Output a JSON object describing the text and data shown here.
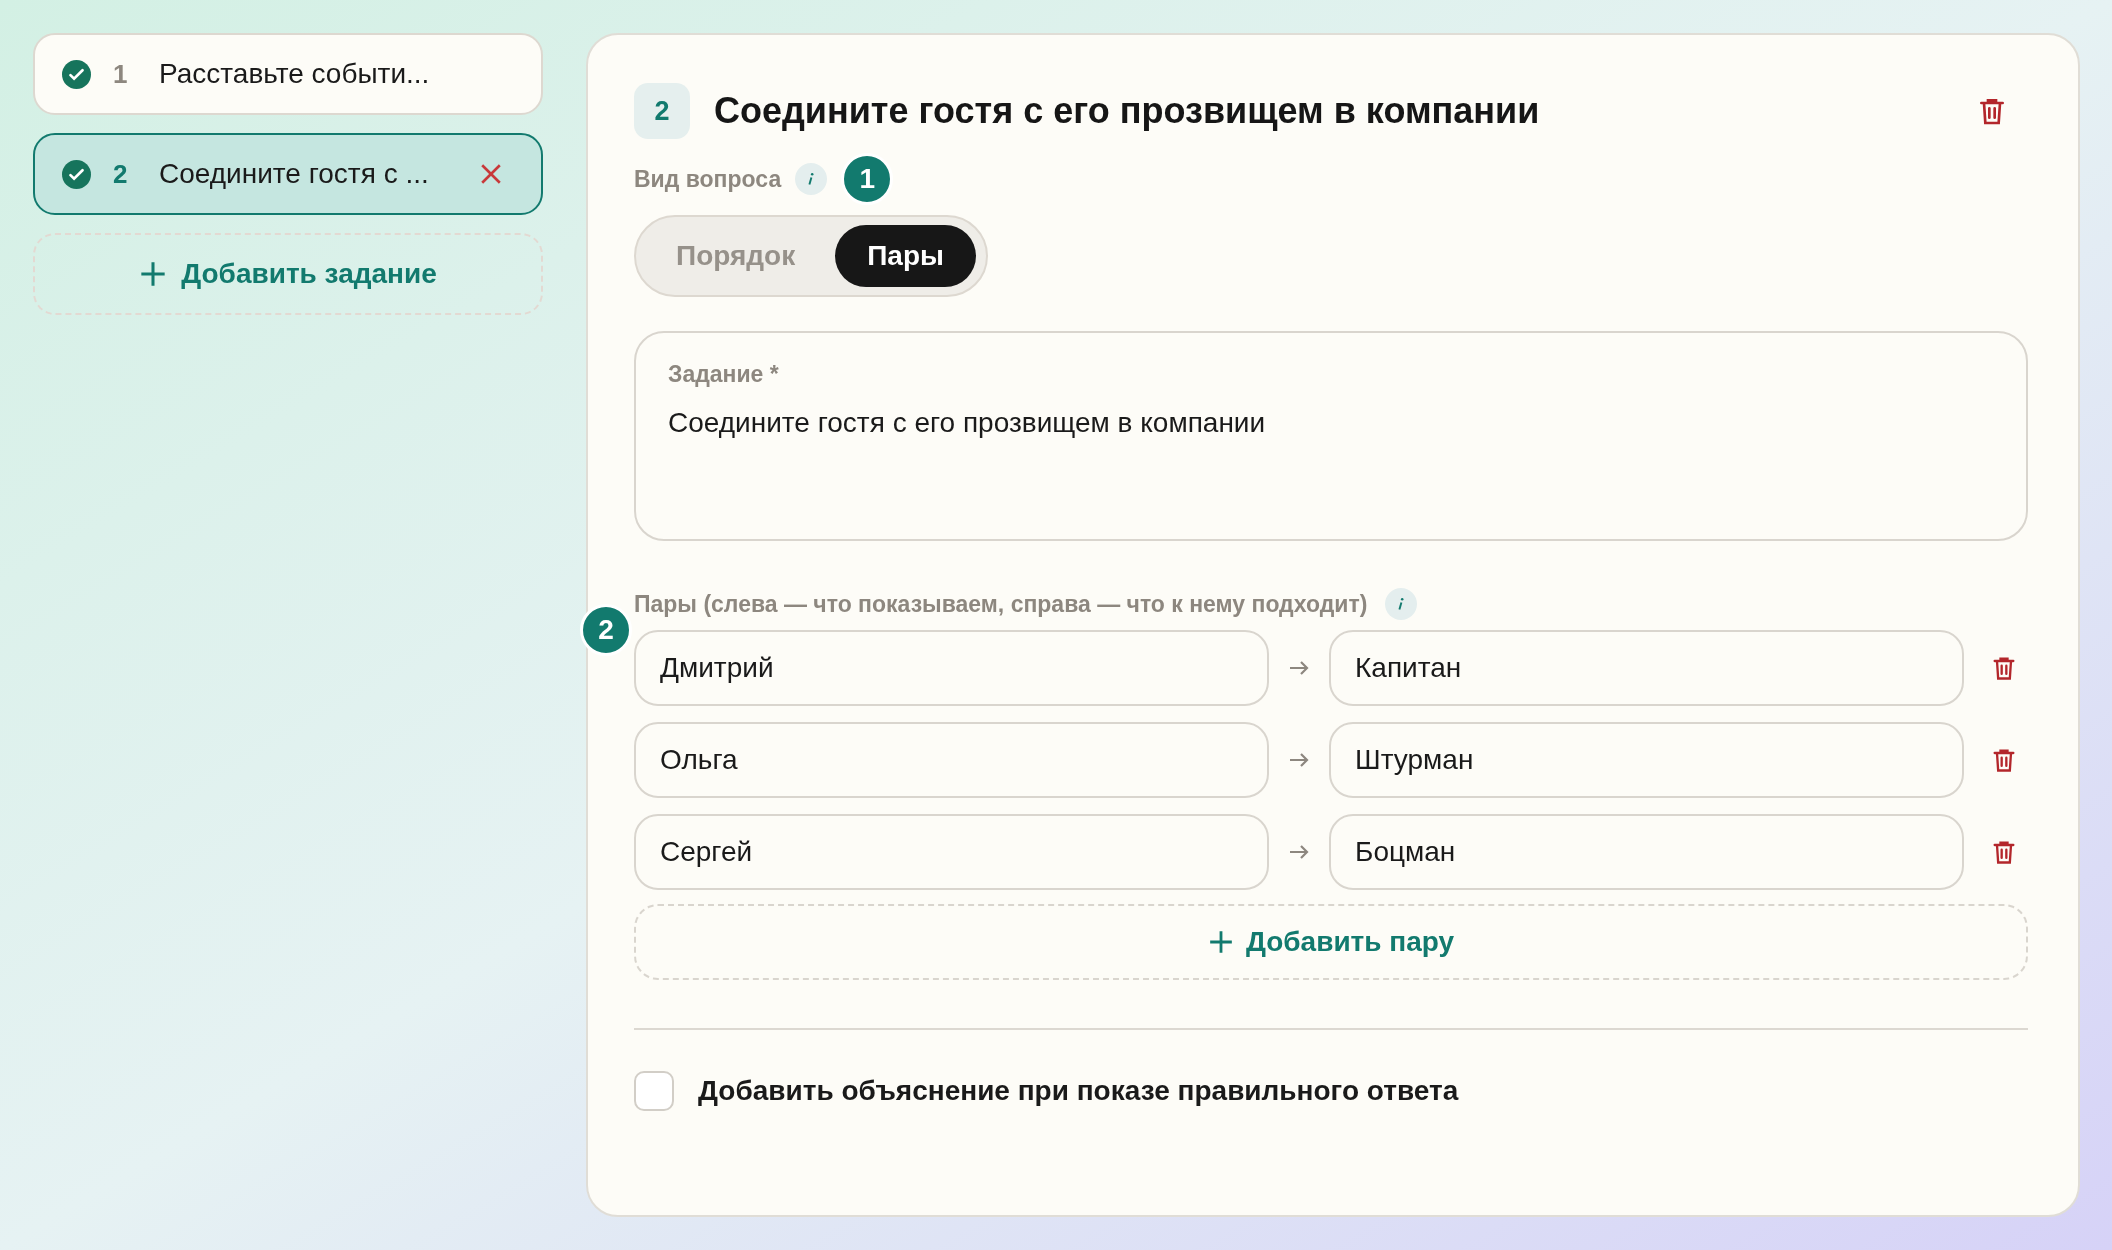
{
  "sidebar": {
    "tasks": [
      {
        "number": "1",
        "title": "Расставьте событи...",
        "done": true,
        "selected": false
      },
      {
        "number": "2",
        "title": "Соедините гостя с ...",
        "done": true,
        "selected": true
      }
    ],
    "add_button": "Добавить задание"
  },
  "editor": {
    "number": "2",
    "title": "Соедините гостя с его прозвищем в компании",
    "question_type": {
      "label": "Вид вопроса",
      "step": "1",
      "options": [
        {
          "label": "Порядок",
          "selected": false
        },
        {
          "label": "Пары",
          "selected": true
        }
      ]
    },
    "task_field": {
      "label": "Задание *",
      "value": "Соедините гостя с его прозвищем в компании"
    },
    "pairs": {
      "label": "Пары (слева — что показываем, справа — что к нему подходит)",
      "step": "2",
      "rows": [
        {
          "left": "Дмитрий",
          "right": "Капитан"
        },
        {
          "left": "Ольга",
          "right": "Штурман"
        },
        {
          "left": "Сергей",
          "right": "Боцман"
        }
      ],
      "add_button": "Добавить пару"
    },
    "explanation": {
      "label": "Добавить объяснение при показе правильного ответа",
      "checked": false
    }
  }
}
